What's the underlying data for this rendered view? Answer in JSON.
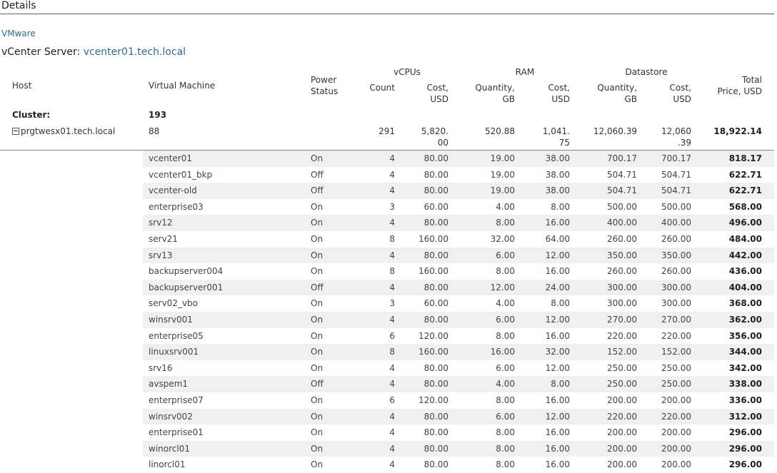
{
  "title": "Details",
  "breadcrumb": "VMware",
  "vcenter": {
    "label": "vCenter Server:",
    "name": "vcenter01.tech.local"
  },
  "headers": {
    "host": "Host",
    "vm": "Virtual Machine",
    "power_l1": "Power",
    "power_l2": "Status",
    "vcpus": "vCPUs",
    "count": "Count",
    "cost_l1": "Cost,",
    "cost_l2": "USD",
    "ram": "RAM",
    "qty_l1": "Quantity,",
    "qty_l2": "GB",
    "datastore": "Datastore",
    "total_l1": "Total",
    "total_l2": "Price, USD"
  },
  "cluster": {
    "label": "Cluster:",
    "value": "193"
  },
  "host_row": {
    "name": "prgtwesx01.tech.local",
    "vms": "88",
    "cpu_count": "291",
    "cpu_cost_a": "5,820.",
    "cpu_cost_b": "00",
    "ram_qty": "520.88",
    "ram_cost_a": "1,041.",
    "ram_cost_b": "75",
    "ds_qty": "12,060.39",
    "ds_cost_a": "12,060",
    "ds_cost_b": ".39",
    "total": "18,922.14"
  },
  "vms": [
    {
      "name": "vcenter01",
      "power": "On",
      "count": "4",
      "cpu_cost": "80.00",
      "ram_qty": "19.00",
      "ram_cost": "38.00",
      "ds_qty": "700.17",
      "ds_cost": "700.17",
      "total": "818.17"
    },
    {
      "name": "vcenter01_bkp",
      "power": "Off",
      "count": "4",
      "cpu_cost": "80.00",
      "ram_qty": "19.00",
      "ram_cost": "38.00",
      "ds_qty": "504.71",
      "ds_cost": "504.71",
      "total": "622.71"
    },
    {
      "name": "vcenter-old",
      "power": "Off",
      "count": "4",
      "cpu_cost": "80.00",
      "ram_qty": "19.00",
      "ram_cost": "38.00",
      "ds_qty": "504.71",
      "ds_cost": "504.71",
      "total": "622.71"
    },
    {
      "name": "enterprise03",
      "power": "On",
      "count": "3",
      "cpu_cost": "60.00",
      "ram_qty": "4.00",
      "ram_cost": "8.00",
      "ds_qty": "500.00",
      "ds_cost": "500.00",
      "total": "568.00"
    },
    {
      "name": "srv12",
      "power": "On",
      "count": "4",
      "cpu_cost": "80.00",
      "ram_qty": "8.00",
      "ram_cost": "16.00",
      "ds_qty": "400.00",
      "ds_cost": "400.00",
      "total": "496.00"
    },
    {
      "name": "serv21",
      "power": "On",
      "count": "8",
      "cpu_cost": "160.00",
      "ram_qty": "32.00",
      "ram_cost": "64.00",
      "ds_qty": "260.00",
      "ds_cost": "260.00",
      "total": "484.00"
    },
    {
      "name": "srv13",
      "power": "On",
      "count": "4",
      "cpu_cost": "80.00",
      "ram_qty": "6.00",
      "ram_cost": "12.00",
      "ds_qty": "350.00",
      "ds_cost": "350.00",
      "total": "442.00"
    },
    {
      "name": "backupserver004",
      "power": "On",
      "count": "8",
      "cpu_cost": "160.00",
      "ram_qty": "8.00",
      "ram_cost": "16.00",
      "ds_qty": "260.00",
      "ds_cost": "260.00",
      "total": "436.00"
    },
    {
      "name": "backupserver001",
      "power": "Off",
      "count": "4",
      "cpu_cost": "80.00",
      "ram_qty": "12.00",
      "ram_cost": "24.00",
      "ds_qty": "300.00",
      "ds_cost": "300.00",
      "total": "404.00"
    },
    {
      "name": "serv02_vbo",
      "power": "On",
      "count": "3",
      "cpu_cost": "60.00",
      "ram_qty": "4.00",
      "ram_cost": "8.00",
      "ds_qty": "300.00",
      "ds_cost": "300.00",
      "total": "368.00"
    },
    {
      "name": "winsrv001",
      "power": "On",
      "count": "4",
      "cpu_cost": "80.00",
      "ram_qty": "6.00",
      "ram_cost": "12.00",
      "ds_qty": "270.00",
      "ds_cost": "270.00",
      "total": "362.00"
    },
    {
      "name": "enterprise05",
      "power": "On",
      "count": "6",
      "cpu_cost": "120.00",
      "ram_qty": "8.00",
      "ram_cost": "16.00",
      "ds_qty": "220.00",
      "ds_cost": "220.00",
      "total": "356.00"
    },
    {
      "name": "linuxsrv001",
      "power": "On",
      "count": "8",
      "cpu_cost": "160.00",
      "ram_qty": "16.00",
      "ram_cost": "32.00",
      "ds_qty": "152.00",
      "ds_cost": "152.00",
      "total": "344.00"
    },
    {
      "name": "srv16",
      "power": "On",
      "count": "4",
      "cpu_cost": "80.00",
      "ram_qty": "6.00",
      "ram_cost": "12.00",
      "ds_qty": "250.00",
      "ds_cost": "250.00",
      "total": "342.00"
    },
    {
      "name": "avspem1",
      "power": "Off",
      "count": "4",
      "cpu_cost": "80.00",
      "ram_qty": "4.00",
      "ram_cost": "8.00",
      "ds_qty": "250.00",
      "ds_cost": "250.00",
      "total": "338.00"
    },
    {
      "name": "enterprise07",
      "power": "On",
      "count": "6",
      "cpu_cost": "120.00",
      "ram_qty": "8.00",
      "ram_cost": "16.00",
      "ds_qty": "200.00",
      "ds_cost": "200.00",
      "total": "336.00"
    },
    {
      "name": "winsrv002",
      "power": "On",
      "count": "4",
      "cpu_cost": "80.00",
      "ram_qty": "6.00",
      "ram_cost": "12.00",
      "ds_qty": "220.00",
      "ds_cost": "220.00",
      "total": "312.00"
    },
    {
      "name": "enterprise01",
      "power": "On",
      "count": "4",
      "cpu_cost": "80.00",
      "ram_qty": "8.00",
      "ram_cost": "16.00",
      "ds_qty": "200.00",
      "ds_cost": "200.00",
      "total": "296.00"
    },
    {
      "name": "winorcl01",
      "power": "On",
      "count": "4",
      "cpu_cost": "80.00",
      "ram_qty": "8.00",
      "ram_cost": "16.00",
      "ds_qty": "200.00",
      "ds_cost": "200.00",
      "total": "296.00"
    },
    {
      "name": "linorcl01",
      "power": "On",
      "count": "4",
      "cpu_cost": "80.00",
      "ram_qty": "8.00",
      "ram_cost": "16.00",
      "ds_qty": "200.00",
      "ds_cost": "200.00",
      "total": "296.00"
    }
  ]
}
